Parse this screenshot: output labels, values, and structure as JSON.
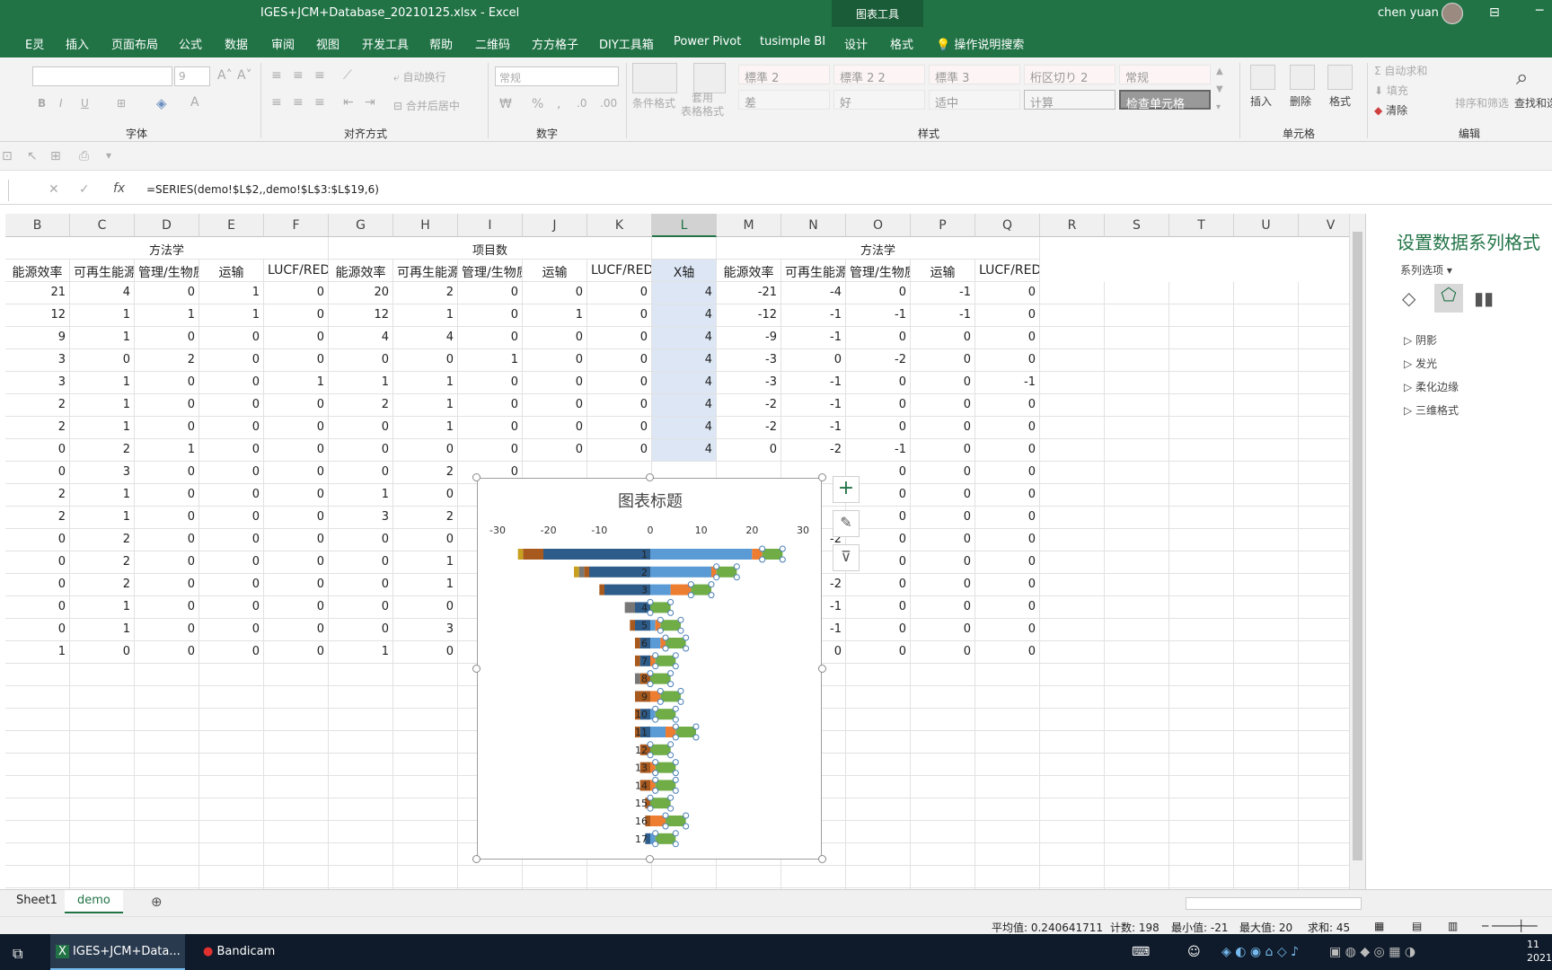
{
  "window": {
    "doc_title": "IGES+JCM+Database_20210125.xlsx  -  Excel",
    "context_tools": "图表工具",
    "user": "chen yuan"
  },
  "tabs": [
    "E灵",
    "插入",
    "页面布局",
    "公式",
    "数据",
    "审阅",
    "视图",
    "开发工具",
    "帮助",
    "二维码",
    "方方格子",
    "DIY工具箱",
    "Power Pivot",
    "tusimple BI",
    "设计",
    "格式"
  ],
  "tell_me": "操作说明搜索",
  "ribbon": {
    "groups": {
      "font": "字体",
      "align": "对齐方式",
      "number": "数字",
      "styles": "样式",
      "cells": "单元格",
      "edit": "编辑"
    },
    "font_size": "9",
    "wrap": "自动换行",
    "merge": "合并后居中",
    "number_format": "常规",
    "cond_format": "条件格式",
    "table_format": "套用\n表格格式",
    "styles_row1": [
      "標準 2",
      "標準 2 2",
      "標準 3",
      "桁区切り 2",
      "常规"
    ],
    "styles_row2": [
      "差",
      "好",
      "适中",
      "计算",
      "检查单元格"
    ],
    "insert": "插入",
    "delete": "删除",
    "format": "格式",
    "autosum": "自动求和",
    "fill": "填充",
    "clear": "清除",
    "sort": "排序和筛选",
    "find": "查找和选"
  },
  "formula": "=SERIES(demo!$L$2,,demo!$L$3:$L$19,6)",
  "columns": [
    "B",
    "C",
    "D",
    "E",
    "F",
    "G",
    "H",
    "I",
    "J",
    "K",
    "L",
    "M",
    "N",
    "O",
    "P",
    "Q",
    "R",
    "S",
    "T",
    "U",
    "V"
  ],
  "header_row1": {
    "B": "方法学",
    "H": "项目数",
    "N": "方法学"
  },
  "header_row2": [
    "能源效率",
    "可再生能源",
    "管理/生物质",
    "运输",
    "LUCF/REDD+",
    "能源效率",
    "可再生能源",
    "管理/生物质",
    "运输",
    "LUCF/RED",
    "X轴",
    "能源效率",
    "可再生能源",
    "管理/生物质",
    "运输",
    "LUCF/REDD+"
  ],
  "rows": [
    [
      21,
      4,
      0,
      1,
      0,
      20,
      2,
      0,
      0,
      0,
      4,
      -21,
      -4,
      0,
      -1,
      0
    ],
    [
      12,
      1,
      1,
      1,
      0,
      12,
      1,
      0,
      1,
      0,
      4,
      -12,
      -1,
      -1,
      -1,
      0
    ],
    [
      9,
      1,
      0,
      0,
      0,
      4,
      4,
      0,
      0,
      0,
      4,
      -9,
      -1,
      0,
      0,
      0
    ],
    [
      3,
      0,
      2,
      0,
      0,
      0,
      0,
      1,
      0,
      0,
      4,
      -3,
      0,
      -2,
      0,
      0
    ],
    [
      3,
      1,
      0,
      0,
      1,
      1,
      1,
      0,
      0,
      0,
      4,
      -3,
      -1,
      0,
      0,
      -1
    ],
    [
      2,
      1,
      0,
      0,
      0,
      2,
      1,
      0,
      0,
      0,
      4,
      -2,
      -1,
      0,
      0,
      0
    ],
    [
      2,
      1,
      0,
      0,
      0,
      0,
      1,
      0,
      0,
      0,
      4,
      -2,
      -1,
      0,
      0,
      0
    ],
    [
      0,
      2,
      1,
      0,
      0,
      0,
      0,
      0,
      0,
      0,
      4,
      0,
      -2,
      -1,
      0,
      0
    ],
    [
      0,
      3,
      0,
      0,
      0,
      0,
      2,
      0,
      "",
      "",
      "",
      "",
      "",
      "0",
      0,
      0
    ],
    [
      2,
      1,
      0,
      0,
      0,
      1,
      0,
      "",
      "",
      "",
      "",
      "",
      "",
      "0",
      0,
      0
    ],
    [
      2,
      1,
      0,
      0,
      0,
      3,
      2,
      "",
      "",
      "",
      "",
      "",
      "",
      "0",
      0,
      0
    ],
    [
      0,
      2,
      0,
      0,
      0,
      0,
      0,
      "",
      "",
      "",
      "",
      "",
      "-2",
      "0",
      0,
      0
    ],
    [
      0,
      2,
      0,
      0,
      0,
      0,
      1,
      "",
      "",
      "",
      "",
      "",
      "",
      "0",
      0,
      0
    ],
    [
      0,
      2,
      0,
      0,
      0,
      0,
      1,
      "",
      "",
      "",
      "",
      "",
      "-2",
      "0",
      0,
      0
    ],
    [
      0,
      1,
      0,
      0,
      0,
      0,
      0,
      "",
      "",
      "",
      "",
      "",
      "-1",
      "0",
      0,
      0
    ],
    [
      0,
      1,
      0,
      0,
      0,
      0,
      3,
      "",
      "",
      "",
      "",
      "",
      "-1",
      "0",
      0,
      0
    ],
    [
      1,
      0,
      0,
      0,
      0,
      1,
      0,
      "",
      "",
      "",
      "",
      "",
      "0",
      "0",
      0,
      0
    ]
  ],
  "chart_data": {
    "type": "bar",
    "title": "图表标题",
    "xlim": [
      -30,
      30
    ],
    "x_ticks": [
      -30,
      -20,
      -10,
      0,
      10,
      20,
      30
    ],
    "categories": [
      "1",
      "2",
      "3",
      "4",
      "5",
      "6",
      "7",
      "8",
      "9",
      "10",
      "11",
      "12",
      "13",
      "14",
      "15",
      "16",
      "17"
    ],
    "series": [
      {
        "values": [
          -21,
          -12,
          -9,
          -3,
          -3,
          -2,
          -2,
          0,
          0,
          -2,
          -2,
          0,
          0,
          0,
          0,
          0,
          -1
        ],
        "color": "#2e5c8a"
      },
      {
        "values": [
          -4,
          -1,
          -1,
          0,
          -1,
          -1,
          -1,
          -2,
          -3,
          -1,
          -1,
          -2,
          -2,
          -2,
          -1,
          -1,
          0
        ],
        "color": "#a85a1e"
      },
      {
        "values": [
          0,
          -1,
          0,
          -2,
          0,
          0,
          0,
          -1,
          0,
          0,
          0,
          0,
          0,
          0,
          0,
          0,
          0
        ],
        "color": "#777777"
      },
      {
        "values": [
          -1,
          -1,
          0,
          0,
          0,
          0,
          0,
          0,
          0,
          0,
          0,
          0,
          0,
          0,
          0,
          0,
          0
        ],
        "color": "#c8a020"
      },
      {
        "values": [
          20,
          12,
          4,
          0,
          1,
          2,
          0,
          0,
          0,
          1,
          3,
          0,
          0,
          0,
          0,
          0,
          1
        ],
        "color": "#5b9bd5"
      },
      {
        "values": [
          2,
          1,
          4,
          0,
          1,
          1,
          1,
          0,
          2,
          0,
          2,
          0,
          1,
          1,
          0,
          3,
          0
        ],
        "color": "#ed7d31"
      },
      {
        "values": [
          4,
          4,
          4,
          4,
          4,
          4,
          4,
          4,
          4,
          4,
          4,
          4,
          4,
          4,
          4,
          4,
          4
        ],
        "color": "#70ad47"
      }
    ]
  },
  "pane": {
    "title": "设置数据系列格式",
    "options": "系列选项",
    "items": [
      "阴影",
      "发光",
      "柔化边缘",
      "三维格式"
    ]
  },
  "sheets": [
    "Sheet1",
    "demo"
  ],
  "status": {
    "avg": "平均值: 0.240641711",
    "count": "计数: 198",
    "min": "最小值: -21",
    "max": "最大值: 20",
    "sum": "求和: 45"
  },
  "taskbar": {
    "excel": "IGES+JCM+Data...",
    "bandicam": "Bandicam",
    "clock": "11",
    "year": "2021"
  }
}
